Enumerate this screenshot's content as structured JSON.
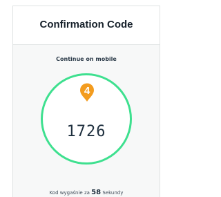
{
  "header": {
    "title": "Confirmation Code"
  },
  "instruction": "Continue on mobile",
  "badge": {
    "step": "4",
    "color": "#f39c1f"
  },
  "code": "1726",
  "ring_color": "#3ee08f",
  "expiry": {
    "prefix": "Kod wygaśnie za",
    "seconds": "58",
    "suffix": "Sekundy"
  }
}
